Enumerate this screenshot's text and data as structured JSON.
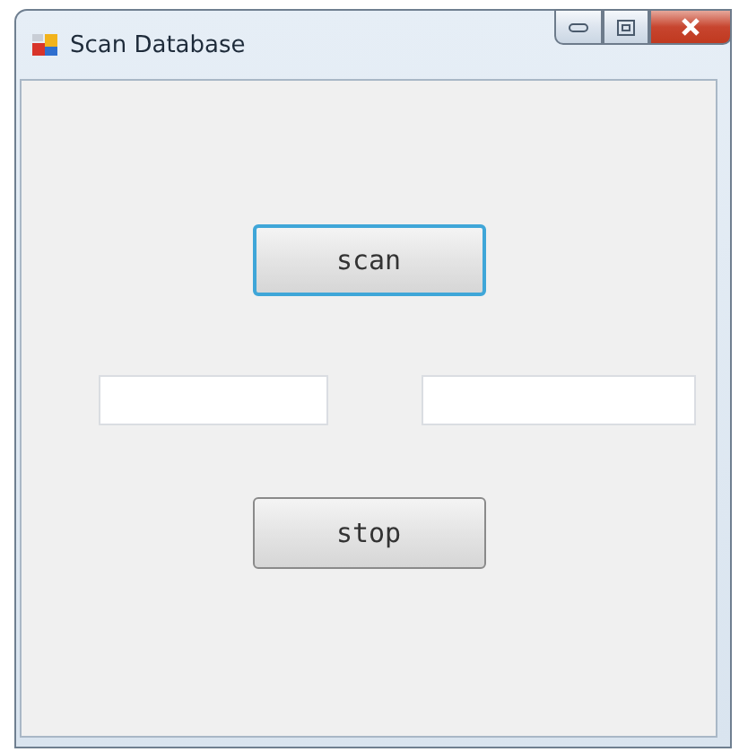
{
  "window": {
    "title": "Scan Database"
  },
  "buttons": [
    {
      "label": "scan",
      "focused": true
    }
  ],
  "fields": [
    {
      "kind": "short"
    },
    {
      "kind": "long"
    }
  ],
  "bottom_buttons": [
    {
      "label": "stop",
      "focused": false
    }
  ]
}
